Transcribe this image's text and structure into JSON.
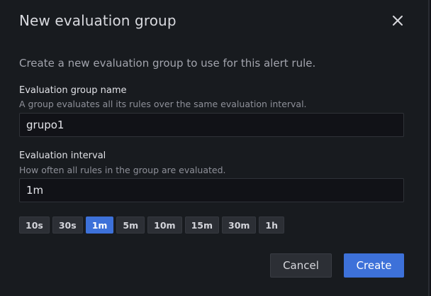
{
  "dialog": {
    "title": "New evaluation group",
    "close_icon": "close-icon",
    "description": "Create a new evaluation group to use for this alert rule."
  },
  "group_name": {
    "label": "Evaluation group name",
    "help": "A group evaluates all its rules over the same evaluation interval.",
    "value": "grupo1"
  },
  "interval": {
    "label": "Evaluation interval",
    "help": "How often all rules in the group are evaluated.",
    "value": "1m",
    "presets": [
      "10s",
      "30s",
      "1m",
      "5m",
      "10m",
      "15m",
      "30m",
      "1h"
    ],
    "selected": "1m"
  },
  "actions": {
    "cancel_label": "Cancel",
    "create_label": "Create"
  },
  "colors": {
    "accent": "#3d71d9",
    "background": "#181b1f"
  }
}
